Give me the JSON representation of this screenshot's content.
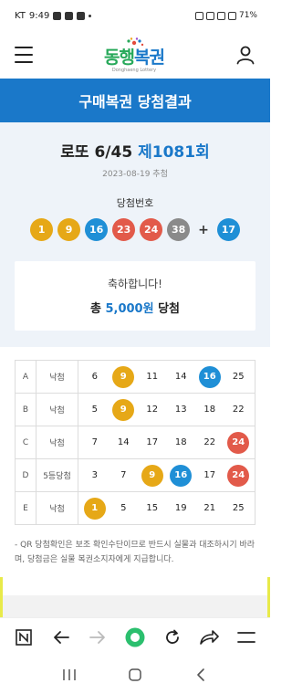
{
  "status_bar": {
    "time": "9:49",
    "carrier": "KT",
    "battery": "71%"
  },
  "header": {
    "logo_main_1": "동행",
    "logo_main_2": "복권",
    "logo_sub": "Donghaeng Lottery"
  },
  "page_title": "구매복권 당첨결과",
  "draw": {
    "game": "로또 6/45",
    "round": "제1081회",
    "date": "2023-08-19 추첨"
  },
  "winning": {
    "label": "당첨번호",
    "numbers": [
      1,
      9,
      16,
      23,
      24,
      38
    ],
    "bonus": 17,
    "plus": "+"
  },
  "prize": {
    "message": "축하합니다!",
    "total_prefix": "총",
    "amount": "5,000원",
    "total_suffix": "당첨"
  },
  "ticket": [
    {
      "line": "A",
      "result": "낙첨",
      "numbers": [
        6,
        9,
        11,
        14,
        16,
        25
      ]
    },
    {
      "line": "B",
      "result": "낙첨",
      "numbers": [
        5,
        9,
        12,
        13,
        18,
        22
      ]
    },
    {
      "line": "C",
      "result": "낙첨",
      "numbers": [
        7,
        14,
        17,
        18,
        22,
        24
      ]
    },
    {
      "line": "D",
      "result": "5등당첨",
      "numbers": [
        3,
        7,
        9,
        16,
        17,
        24
      ]
    },
    {
      "line": "E",
      "result": "낙첨",
      "numbers": [
        1,
        5,
        15,
        19,
        21,
        25
      ]
    }
  ],
  "notice": "- QR 당첨확인은 보조 확인수단이므로 반드시 실물과 대조하시기 바라며, 당첨금은 실물 복권소지자에게 지급합니다.",
  "ball_colors": {
    "yellow": "#e6a817",
    "blue": "#1f8fd6",
    "red": "#e25a4a",
    "gray": "#8a8a8a",
    "green": "#2bbf6e"
  }
}
